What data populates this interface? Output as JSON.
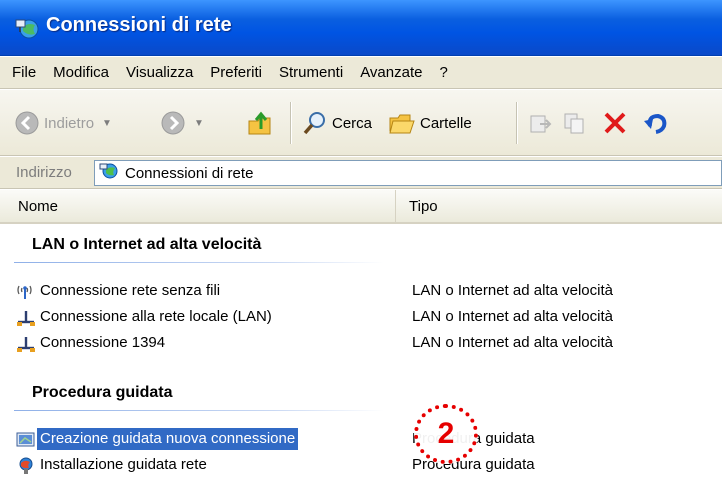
{
  "window": {
    "title": "Connessioni di rete"
  },
  "menu": [
    "File",
    "Modifica",
    "Visualizza",
    "Preferiti",
    "Strumenti",
    "Avanzate",
    "?"
  ],
  "toolbar": {
    "back_label": "Indietro",
    "search_label": "Cerca",
    "folders_label": "Cartelle",
    "icons": [
      "back-arrow-icon",
      "forward-arrow-icon",
      "folder-up-icon",
      "search-magnifier-icon",
      "folders-icon",
      "move-to-icon",
      "copy-to-icon",
      "delete-x-icon",
      "undo-icon"
    ]
  },
  "address": {
    "label": "Indirizzo",
    "value": "Connessioni di rete"
  },
  "columns": {
    "name": "Nome",
    "type": "Tipo"
  },
  "groups": [
    {
      "title": "LAN o Internet ad alta velocità",
      "items": [
        {
          "name": "Connessione rete senza fili",
          "type": "LAN o Internet ad alta velocità",
          "icon": "wireless-icon"
        },
        {
          "name": "Connessione alla rete locale (LAN)",
          "type": "LAN o Internet ad alta velocità",
          "icon": "lan-icon"
        },
        {
          "name": "Connessione 1394",
          "type": "LAN o Internet ad alta velocità",
          "icon": "lan-icon"
        }
      ]
    },
    {
      "title": "Procedura guidata",
      "items": [
        {
          "name": "Creazione guidata nuova connessione",
          "type": "Procedura guidata",
          "icon": "new-connection-wizard-icon",
          "selected": true
        },
        {
          "name": "Installazione guidata rete",
          "type": "Procedura guidata",
          "icon": "network-setup-wizard-icon"
        }
      ]
    }
  ],
  "callout": {
    "number": "2"
  },
  "colors": {
    "titlebar": "#0054e3",
    "selection": "#316ac5",
    "callout": "#e60000",
    "chrome": "#ece9d8"
  }
}
